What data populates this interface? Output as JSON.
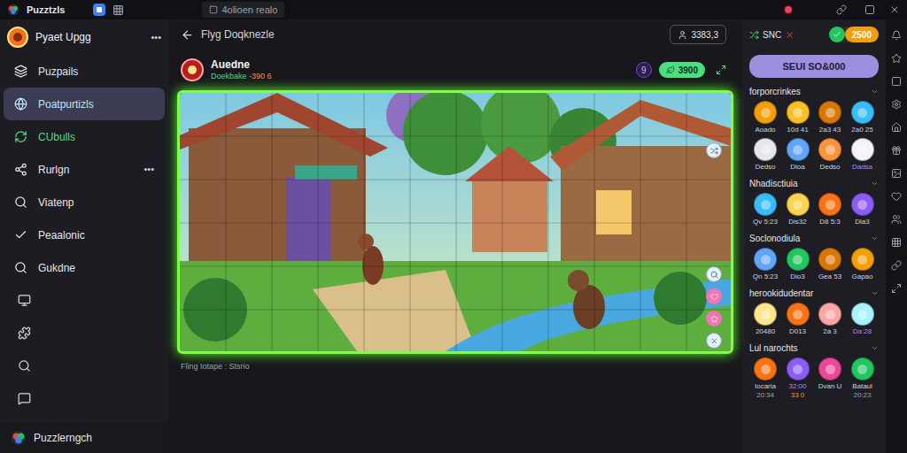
{
  "app": {
    "name": "Puzztzls",
    "tab_title": "4olioen realo"
  },
  "sidebar": {
    "profile": {
      "name": "Pyaet Upgg",
      "menu": "•••"
    },
    "items": [
      {
        "label": "Puzpails",
        "selected": false,
        "color": "#e5e7eb"
      },
      {
        "label": "Poatpurtizls",
        "selected": true,
        "color": "#bfe3ff"
      },
      {
        "label": "CUbulls",
        "selected": false,
        "color": "#4ade80"
      },
      {
        "label": "Rurlgn",
        "selected": false,
        "color": "#e5e7eb",
        "menu": "•••"
      },
      {
        "label": "Viatenp",
        "selected": false,
        "color": "#e5e7eb"
      },
      {
        "label": "Peaalonic",
        "selected": false,
        "color": "#e5e7eb"
      },
      {
        "label": "Gukdne",
        "selected": false,
        "color": "#e5e7eb"
      }
    ],
    "footer": "Puzzlerngch"
  },
  "page": {
    "title": "Flyg Doqknezle",
    "action": "3383,3"
  },
  "game": {
    "player": "Auedne",
    "subtitle": "Doekbake",
    "score": "-390 6",
    "badge": "9",
    "coins": "3900",
    "caption": "Fling Iotape : Stsrio"
  },
  "wallet": {
    "status": "SNC",
    "coins": "2500",
    "button": "SEUI SO&000"
  },
  "sections": [
    {
      "title": "forporcrinkes",
      "items": [
        {
          "label": "Aoado",
          "color": "#f59e0b",
          "highlighted": false
        },
        {
          "label": "10d 41",
          "color": "#fbbf24",
          "highlighted": false
        },
        {
          "label": "2a3 43",
          "color": "#d97706",
          "highlighted": false
        },
        {
          "label": "2a0 25",
          "color": "#38bdf8",
          "highlighted": false
        },
        {
          "label": "Dedso",
          "color": "#e5e7eb",
          "highlighted": false
        },
        {
          "label": "Dloa",
          "color": "#60a5fa",
          "highlighted": false
        },
        {
          "label": "Dedso",
          "color": "#fb923c",
          "highlighted": false
        },
        {
          "label": "Dadsa",
          "color": "#f3f4f6",
          "highlighted": true
        }
      ]
    },
    {
      "title": "Nhadisctiuia",
      "items": [
        {
          "label": "Qv 5:23",
          "color": "#38bdf8",
          "highlighted": false
        },
        {
          "label": "Dis32",
          "color": "#fcd34d",
          "highlighted": false
        },
        {
          "label": "D8 5:3",
          "color": "#f97316",
          "highlighted": false
        },
        {
          "label": "Dla3",
          "color": "#8b5cf6",
          "highlighted": false
        }
      ]
    },
    {
      "title": "Soclonodiula",
      "items": [
        {
          "label": "Qn 5:23",
          "color": "#60a5fa",
          "highlighted": false
        },
        {
          "label": "Dio3",
          "color": "#22c55e",
          "highlighted": false
        },
        {
          "label": "Gea 53",
          "color": "#d97706",
          "highlighted": false
        },
        {
          "label": "Gapao",
          "color": "#f59e0b",
          "highlighted": false
        }
      ]
    },
    {
      "title": "herookidudentar",
      "items": [
        {
          "label": "20480",
          "color": "#fde68a",
          "highlighted": false
        },
        {
          "label": "D013",
          "color": "#f97316",
          "highlighted": false
        },
        {
          "label": "2a 3",
          "color": "#fca5a5",
          "highlighted": false
        },
        {
          "label": "Da:28",
          "color": "#a5f3fc",
          "highlighted": true
        }
      ]
    },
    {
      "title": "Lul narochts",
      "items": [
        {
          "label": "Iocaria",
          "sub": "20:34",
          "color": "#f97316",
          "highlighted": false
        },
        {
          "label": "32:00",
          "sub": "33 0",
          "color": "#8b5cf6",
          "highlighted": true
        },
        {
          "label": "Dvan U",
          "color": "#ec4899",
          "highlighted": false
        },
        {
          "label": "Bataul",
          "sub": "20:23",
          "color": "#22c55e",
          "highlighted": false
        }
      ]
    }
  ]
}
